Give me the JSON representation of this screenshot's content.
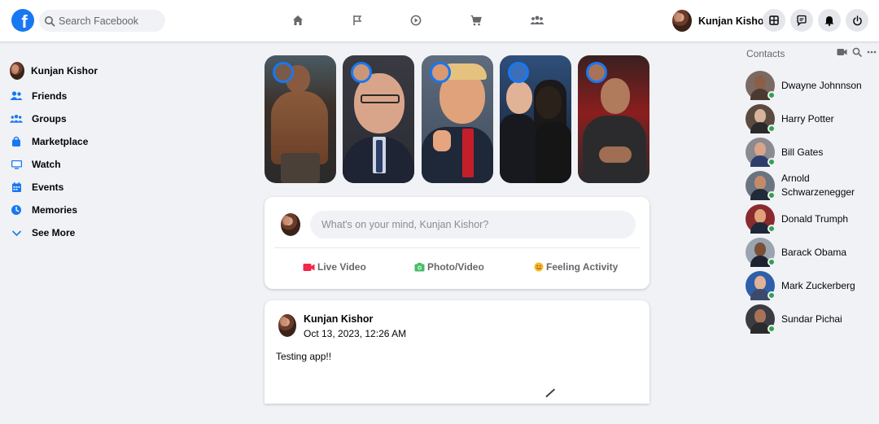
{
  "header": {
    "search_placeholder": "Search Facebook",
    "user_name": "Kunjan Kishor",
    "logo_letter": "f"
  },
  "sidebar": {
    "profile_name": "Kunjan Kishor",
    "items": [
      {
        "label": "Friends",
        "icon": "friends-icon"
      },
      {
        "label": "Groups",
        "icon": "groups-icon"
      },
      {
        "label": "Marketplace",
        "icon": "marketplace-icon"
      },
      {
        "label": "Watch",
        "icon": "watch-icon"
      },
      {
        "label": "Events",
        "icon": "events-icon"
      },
      {
        "label": "Memories",
        "icon": "memories-icon"
      },
      {
        "label": "See More",
        "icon": "chevron-down-icon"
      }
    ]
  },
  "composer": {
    "placeholder": "What's on your mind, Kunjan Kishor?",
    "actions": [
      {
        "label": "Live Video",
        "icon": "video-camera-icon",
        "color": "#f02849"
      },
      {
        "label": "Photo/Video",
        "icon": "photo-icon",
        "color": "#45bd62"
      },
      {
        "label": "Feeling Activity",
        "icon": "smiley-icon",
        "color": "#f7b928"
      }
    ]
  },
  "post": {
    "author": "Kunjan Kishor",
    "timestamp": "Oct 13, 2023, 12:26 AM",
    "text": "Testing app!!"
  },
  "contacts": {
    "title": "Contacts",
    "items": [
      {
        "name": "Dwayne Johnnson",
        "online": true
      },
      {
        "name": "Harry Potter",
        "online": true
      },
      {
        "name": "Bill Gates",
        "online": true
      },
      {
        "name": "Arnold Schwarzenegger",
        "online": true
      },
      {
        "name": "Donald Trumph",
        "online": true
      },
      {
        "name": "Barack Obama",
        "online": true
      },
      {
        "name": "Mark Zuckerberg",
        "online": true
      },
      {
        "name": "Sundar Pichai",
        "online": true
      }
    ]
  },
  "colors": {
    "brand": "#1877f2",
    "background": "#f0f2f5",
    "online": "#31a24c"
  }
}
